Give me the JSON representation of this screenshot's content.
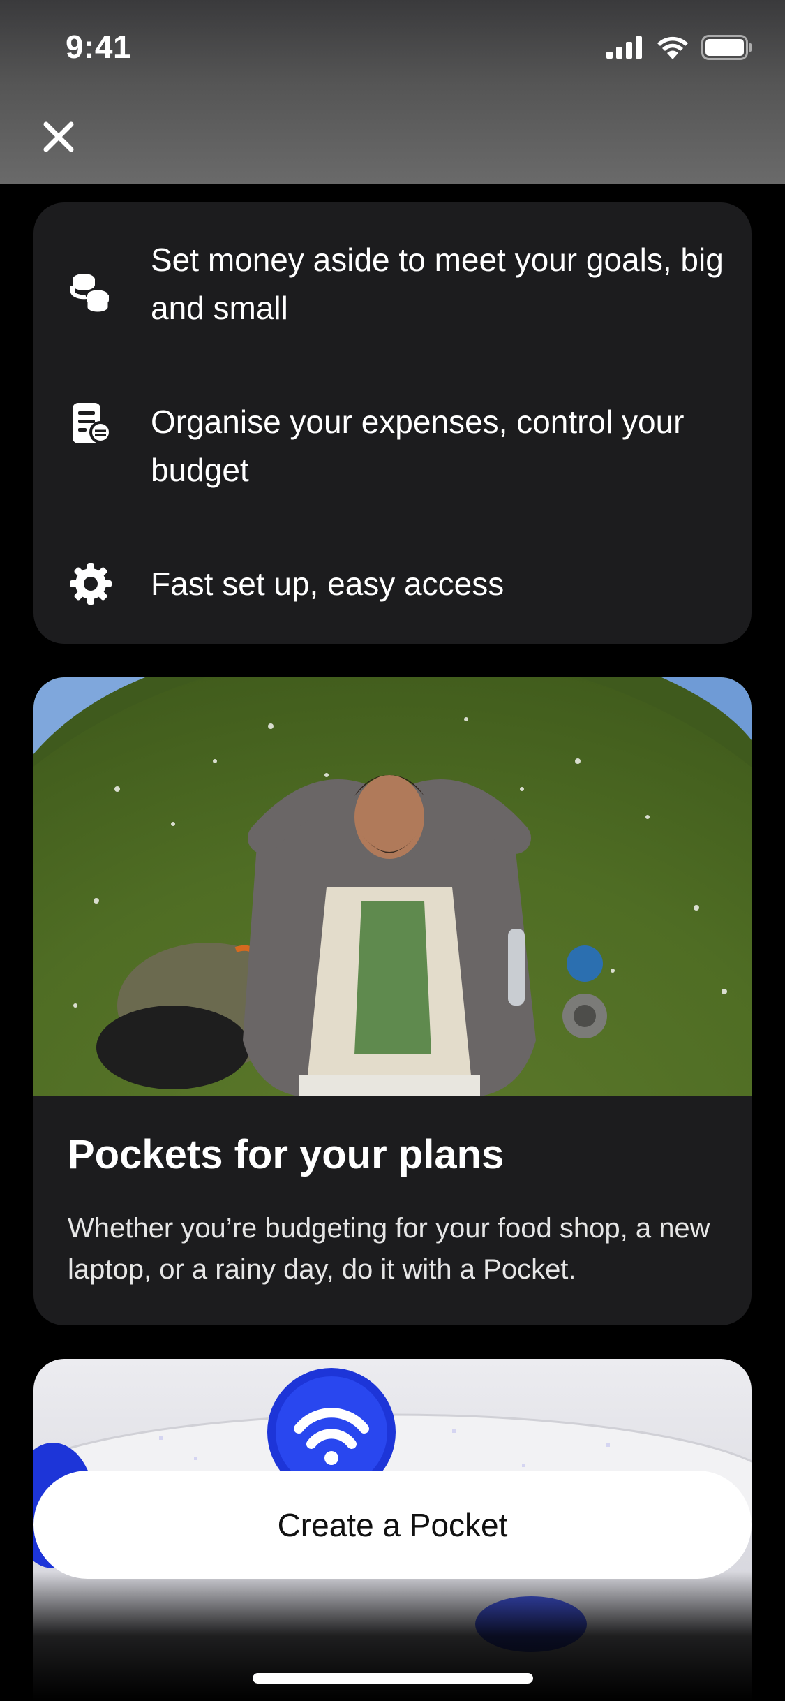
{
  "status_bar": {
    "time": "9:41"
  },
  "features": [
    {
      "icon": "coins-stack-icon",
      "text": "Set money aside to meet your goals, big and small"
    },
    {
      "icon": "receipt-coin-icon",
      "text": "Organise your expenses, control your budget"
    },
    {
      "icon": "gear-icon",
      "text": "Fast set up, easy access"
    }
  ],
  "plans_card": {
    "image": "man-lying-on-grass-photo",
    "title": "Pockets for your plans",
    "description": "Whether you’re budgeting for your food shop, a new laptop, or a rainy day, do it with a Pocket."
  },
  "next_card": {
    "image": "blue-coin-wifi-illustration"
  },
  "cta": {
    "label": "Create a Pocket"
  },
  "colors": {
    "background": "#000000",
    "card": "#1c1c1e",
    "cta_background": "#ffffff",
    "accent_blue": "#1d35d8"
  }
}
